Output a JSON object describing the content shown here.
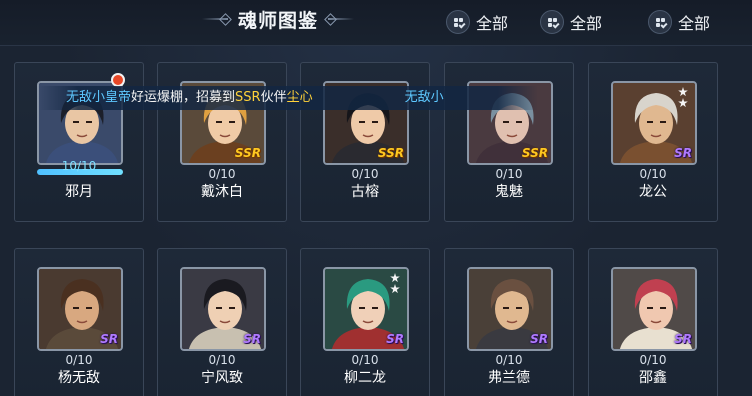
{
  "header": {
    "title": "魂师图鉴",
    "filters": [
      {
        "label": "全部"
      },
      {
        "label": "全部"
      },
      {
        "label": "全部"
      }
    ]
  },
  "broadcast": {
    "user": "无敌小皇帝",
    "text1": "好运爆棚，招募到",
    "rarity": "SSR",
    "text2": "伙伴",
    "hero": "尘心",
    "tail": "无敌小"
  },
  "cards": [
    {
      "name": "邪月",
      "count": "10/10",
      "rarity": "",
      "stars": 0,
      "progress": 1.0,
      "new": true,
      "palette": {
        "bg": "#3a4a6a",
        "hair": "#1c1f2a",
        "skin": "#e9c6a4",
        "cloth": "#3b4f7a"
      }
    },
    {
      "name": "戴沐白",
      "count": "0/10",
      "rarity": "SSR",
      "stars": 0,
      "palette": {
        "bg": "#5a4a3a",
        "hair": "#e0a040",
        "skin": "#f0cba6",
        "cloth": "#6b4020"
      }
    },
    {
      "name": "古榕",
      "count": "0/10",
      "rarity": "SSR",
      "stars": 0,
      "palette": {
        "bg": "#3a2e2a",
        "hair": "#15151a",
        "skin": "#efcaa8",
        "cloth": "#2a2a30"
      }
    },
    {
      "name": "鬼魅",
      "count": "0/10",
      "rarity": "SSR",
      "stars": 0,
      "palette": {
        "bg": "#4a3a40",
        "hair": "#7a90a0",
        "skin": "#e0c0b0",
        "cloth": "#40303a"
      }
    },
    {
      "name": "龙公",
      "count": "0/10",
      "rarity": "SR",
      "stars": 2,
      "palette": {
        "bg": "#5a4030",
        "hair": "#d8d4cc",
        "skin": "#e0b890",
        "cloth": "#7a5030"
      }
    },
    {
      "name": "杨无敌",
      "count": "0/10",
      "rarity": "SR",
      "stars": 0,
      "palette": {
        "bg": "#4a3a30",
        "hair": "#4a3020",
        "skin": "#d8a880",
        "cloth": "#5a4a3a"
      }
    },
    {
      "name": "宁风致",
      "count": "0/10",
      "rarity": "SR",
      "stars": 0,
      "palette": {
        "bg": "#3a3a44",
        "hair": "#1a1a20",
        "skin": "#efd0b4",
        "cloth": "#c8c0b0"
      }
    },
    {
      "name": "柳二龙",
      "count": "0/10",
      "rarity": "SR",
      "stars": 2,
      "palette": {
        "bg": "#2a4a44",
        "hair": "#2a9a80",
        "skin": "#f0d0b8",
        "cloth": "#a03030"
      }
    },
    {
      "name": "弗兰德",
      "count": "0/10",
      "rarity": "SR",
      "stars": 0,
      "palette": {
        "bg": "#4a4038",
        "hair": "#6a5040",
        "skin": "#e0b890",
        "cloth": "#3a3a40"
      }
    },
    {
      "name": "邵鑫",
      "count": "0/10",
      "rarity": "SR",
      "stars": 0,
      "palette": {
        "bg": "#504a48",
        "hair": "#c04050",
        "skin": "#f0c8b0",
        "cloth": "#e8e0d0"
      }
    }
  ]
}
